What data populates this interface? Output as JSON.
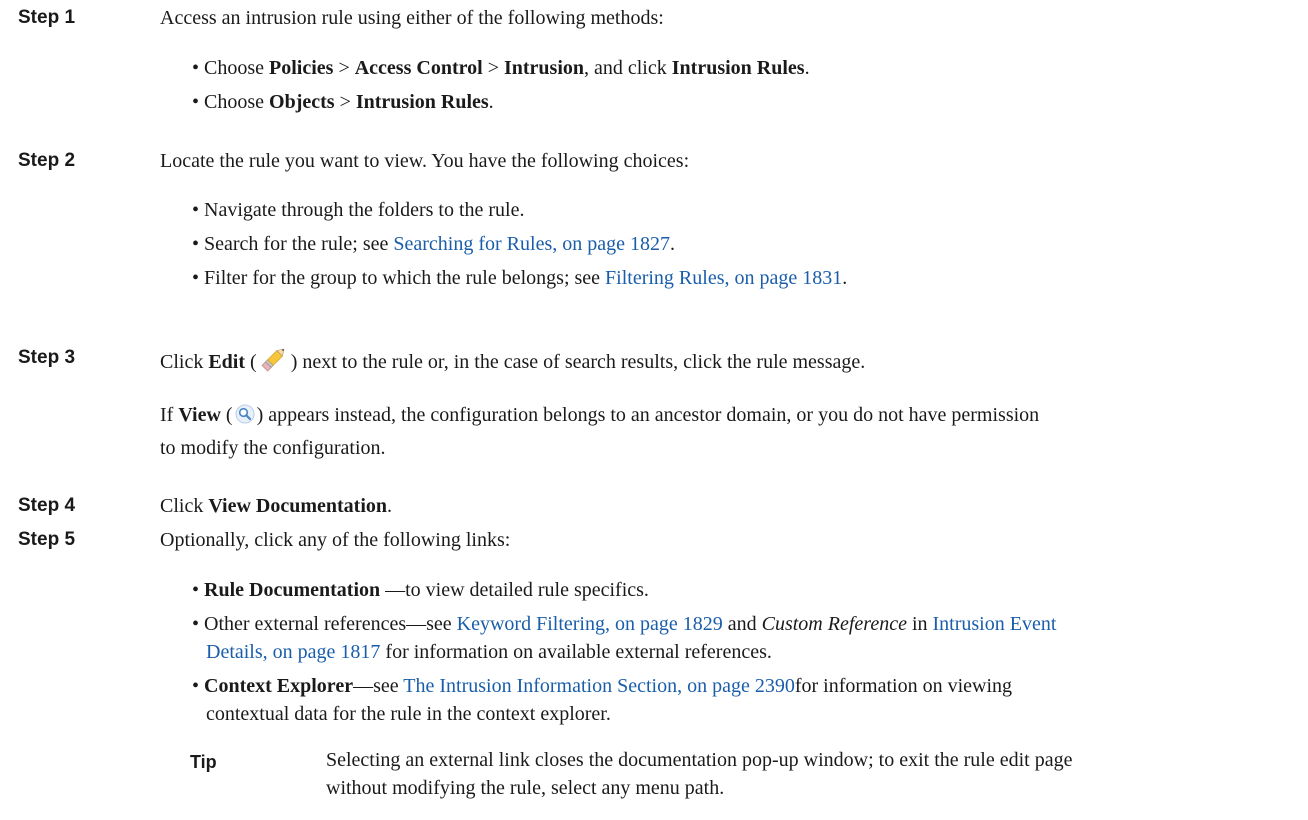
{
  "steps": [
    {
      "label": "Step 1",
      "text": "Access an intrusion rule using either of the following methods:",
      "bullets": {
        "b1": {
          "pre": "Choose ",
          "m1": "Policies",
          "s1": " > ",
          "m2": "Access Control",
          "s2": " > ",
          "m3": "Intrusion",
          "mid": ", and click ",
          "m4": "Intrusion Rules",
          "end": "."
        },
        "b2": {
          "pre": "Choose ",
          "m1": "Objects",
          "s1": " > ",
          "m2": "Intrusion Rules",
          "end": "."
        }
      }
    },
    {
      "label": "Step 2",
      "text": "Locate the rule you want to view. You have the following choices:",
      "bullets": {
        "b1": {
          "text": "Navigate through the folders to the rule."
        },
        "b2": {
          "pre": "Search for the rule; see ",
          "link": "Searching for Rules, on page 1827",
          "end": "."
        },
        "b3": {
          "pre": "Filter for the group to which the rule belongs; see ",
          "link": "Filtering Rules, on page 1831",
          "end": "."
        }
      }
    },
    {
      "label": "Step 3",
      "p1": {
        "pre": "Click ",
        "bold": "Edit",
        "open": " (",
        "close": ")",
        "post": " next to the rule or, in the case of search results, click the rule message."
      },
      "p2": {
        "bold": "View",
        "open": " (",
        "close": ")",
        "line1": " appears instead, the configuration belongs to an ancestor domain, or you do not have permission",
        "line2": "to modify the configuration.",
        "pre": "If "
      }
    },
    {
      "label": "Step 4",
      "pre": "Click ",
      "bold": "View Documentation",
      "end": "."
    },
    {
      "label": "Step 5",
      "text": "Optionally, click any of the following links:",
      "bullets": {
        "b1": {
          "bold": "Rule Documentation",
          "post": " —to view detailed rule specifics."
        },
        "b2": {
          "pre": "Other external references—see ",
          "link1": "Keyword Filtering, on page 1829",
          "and": " and ",
          "ital": "Custom Reference",
          "in": " in ",
          "link2a": "Intrusion Event",
          "link2b": "Details, on page 1817",
          "post": " for information on available external references."
        },
        "b3": {
          "bold": "Context Explorer",
          "dash": "—see ",
          "link": "The Intrusion Information Section, on page 2390",
          "post1": "for information on viewing",
          "post2": "contextual data for the rule in the context explorer."
        }
      }
    }
  ],
  "tip": {
    "label": "Tip",
    "line1": "Selecting an external link closes the documentation pop-up window; to exit the rule edit page",
    "line2": "without modifying the rule, select any menu path."
  },
  "icons": {
    "edit": "pencil-icon",
    "view": "magnifier-icon"
  },
  "colors": {
    "link": "#1a5eab",
    "text": "#1a1a1a"
  }
}
